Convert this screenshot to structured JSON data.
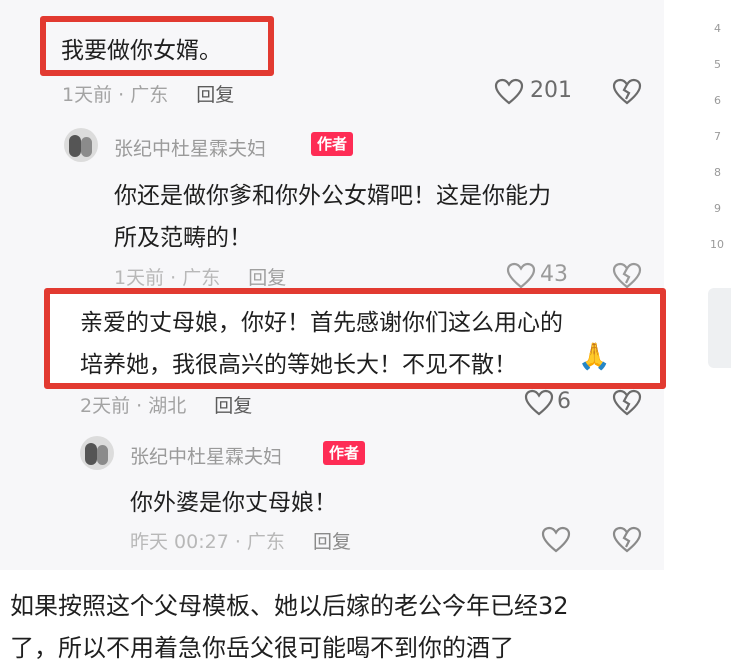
{
  "line_numbers": [
    "4",
    "5",
    "6",
    "7",
    "8",
    "9",
    "10"
  ],
  "comments": [
    {
      "text": "我要做你女婿。",
      "meta_time_loc": "1天前 · 广东",
      "reply_label": "回复",
      "like_count": "201"
    },
    {
      "author": "张纪中杜星霖夫妇",
      "badge": "作者",
      "text_line1": "你还是做你爹和你外公女婿吧！这是你能力",
      "text_line2": "所及范畴的！",
      "meta_time_loc": "1天前 · 广东",
      "reply_label": "回复",
      "like_count": "43"
    },
    {
      "text_line1": "亲爱的丈母娘，你好！首先感谢你们这么用心的",
      "text_line2": "培养她，我很高兴的等她长大！不见不散！",
      "emoji": "🙏",
      "meta_time_loc": "2天前 · 湖北",
      "reply_label": "回复",
      "like_count": "6"
    },
    {
      "author": "张纪中杜星霖夫妇",
      "badge": "作者",
      "text": "你外婆是你丈母娘！",
      "meta_time_loc": "昨天 00:27 · 广东",
      "reply_label": "回复",
      "like_count": ""
    }
  ],
  "footer": {
    "line1": "如果按照这个父母模板、她以后嫁的老公今年已经32",
    "line2": "了，所以不用着急你岳父很可能喝不到你的酒了"
  },
  "colors": {
    "highlight": "#e23a31",
    "badge": "#fe2c55",
    "panel": "#f7f7f9"
  }
}
